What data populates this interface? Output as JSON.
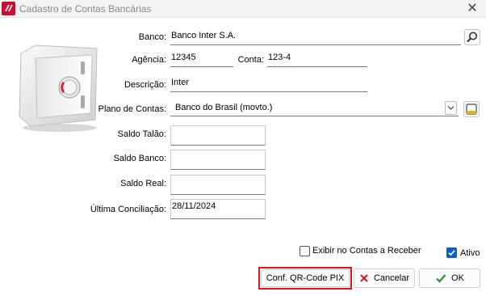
{
  "window": {
    "title": "Cadastro de Contas Bancárias",
    "close_glyph": "✕"
  },
  "form": {
    "banco": {
      "label": "Banco:",
      "value": "Banco Inter S.A."
    },
    "agencia": {
      "label": "Agência:",
      "value": "12345"
    },
    "conta": {
      "label": "Conta:",
      "value": "123-4"
    },
    "descricao": {
      "label": "Descrição:",
      "value": "Inter"
    },
    "plano": {
      "label": "Plano de Contas:",
      "value": "Banco do Brasil (movto.)"
    },
    "saldo_talao": {
      "label": "Saldo Talão:",
      "value": ""
    },
    "saldo_banco": {
      "label": "Saldo Banco:",
      "value": ""
    },
    "saldo_real": {
      "label": "Saldo Real:",
      "value": ""
    },
    "ultima_conciliacao": {
      "label": "Última Conciliação:",
      "value": "28/11/2024"
    }
  },
  "checkboxes": {
    "exibir_contas_receber": {
      "label": "Exibir no Contas a Receber",
      "checked": false
    },
    "ativo": {
      "label": "Ativo",
      "checked": true
    }
  },
  "buttons": {
    "qr_pix": {
      "label": "Conf. QR-Code PIX"
    },
    "cancelar": {
      "label": "Cancelar",
      "icon": "x-icon"
    },
    "ok": {
      "label": "OK",
      "icon": "check-icon"
    }
  },
  "colors": {
    "highlight": "#e0141b",
    "check_blue": "#0a5fc8",
    "cancel_red": "#d11a2a",
    "ok_green": "#1d9a2c"
  }
}
